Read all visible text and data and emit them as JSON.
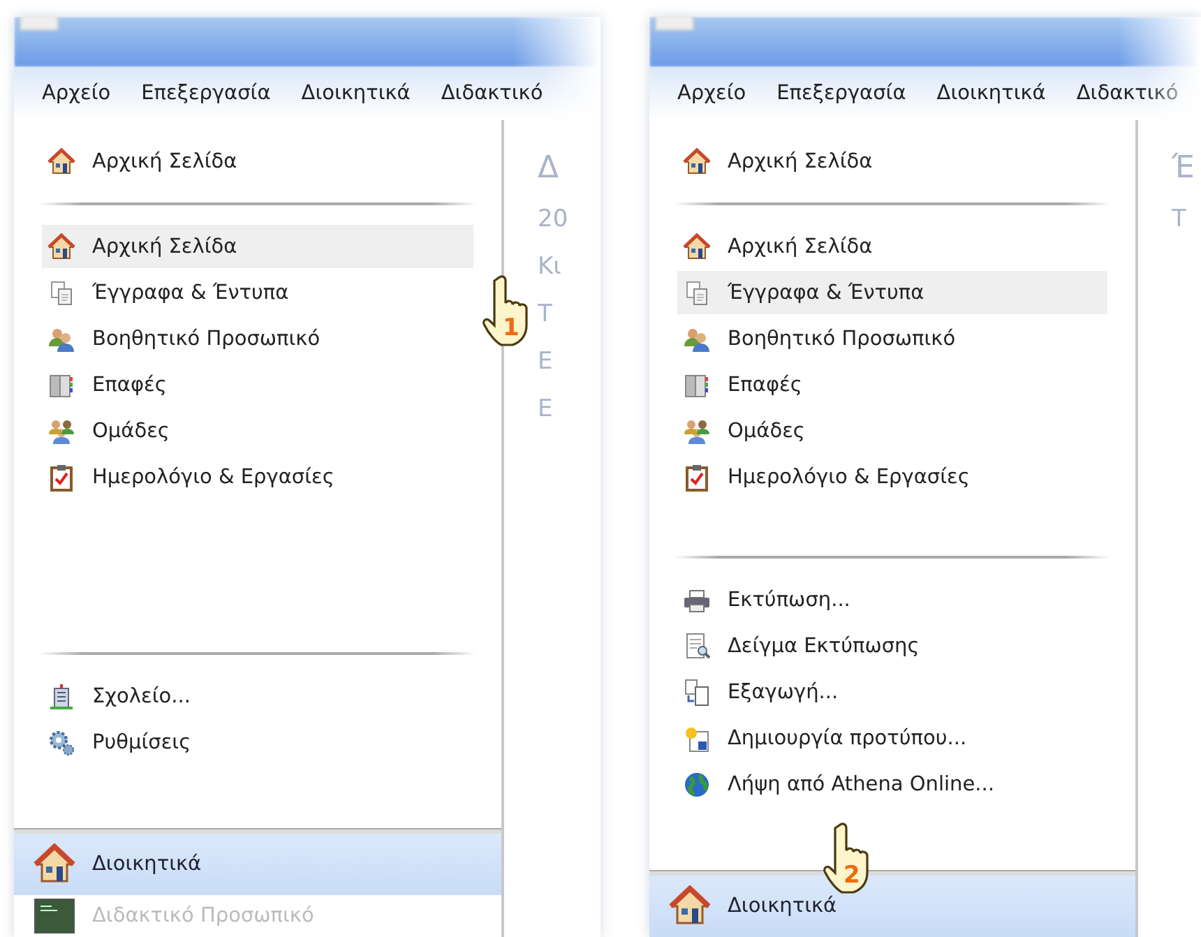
{
  "panels": [
    {
      "menu": [
        {
          "label": "Αρχείο"
        },
        {
          "label": "Επεξεργασία"
        },
        {
          "label": "Διοικητικά"
        },
        {
          "label": "Διδακτικό"
        }
      ],
      "home": {
        "label": "Αρχική Σελίδα"
      },
      "items": [
        {
          "label": "Αρχική Σελίδα",
          "selected": true
        },
        {
          "label": "Έγγραφα & Έντυπα",
          "selected": false
        },
        {
          "label": "Βοηθητικό Προσωπικό",
          "selected": false
        },
        {
          "label": "Επαφές",
          "selected": false
        },
        {
          "label": "Ομάδες",
          "selected": false
        },
        {
          "label": "Ημερολόγιο & Εργασίες",
          "selected": false
        }
      ],
      "actions": [
        {
          "label": "Σχολείο..."
        },
        {
          "label": "Ρυθμίσεις"
        }
      ],
      "nav": [
        {
          "label": "Διοικητικά",
          "selected": true
        },
        {
          "label": "Διδακτικό Προσωπικό",
          "selected": false
        }
      ],
      "content": [
        "Δ",
        "20",
        "Κι",
        "Τ",
        "Ε",
        "Ε"
      ],
      "step": "1"
    },
    {
      "menu": [
        {
          "label": "Αρχείο"
        },
        {
          "label": "Επεξεργασία"
        },
        {
          "label": "Διοικητικά"
        },
        {
          "label": "Διδακτικό"
        }
      ],
      "home": {
        "label": "Αρχική Σελίδα"
      },
      "items": [
        {
          "label": "Αρχική Σελίδα",
          "selected": false
        },
        {
          "label": "Έγγραφα & Έντυπα",
          "selected": true
        },
        {
          "label": "Βοηθητικό Προσωπικό",
          "selected": false
        },
        {
          "label": "Επαφές",
          "selected": false
        },
        {
          "label": "Ομάδες",
          "selected": false
        },
        {
          "label": "Ημερολόγιο & Εργασίες",
          "selected": false
        }
      ],
      "actions": [
        {
          "label": "Εκτύπωση..."
        },
        {
          "label": "Δείγμα Εκτύπωσης"
        },
        {
          "label": "Εξαγωγή..."
        },
        {
          "label": "Δημιουργία προτύπου..."
        },
        {
          "label": "Λήψη από Athena Online..."
        }
      ],
      "nav": [
        {
          "label": "Διοικητικά",
          "selected": true
        }
      ],
      "content": [
        "Έ",
        "Τ"
      ],
      "step": "2"
    }
  ]
}
